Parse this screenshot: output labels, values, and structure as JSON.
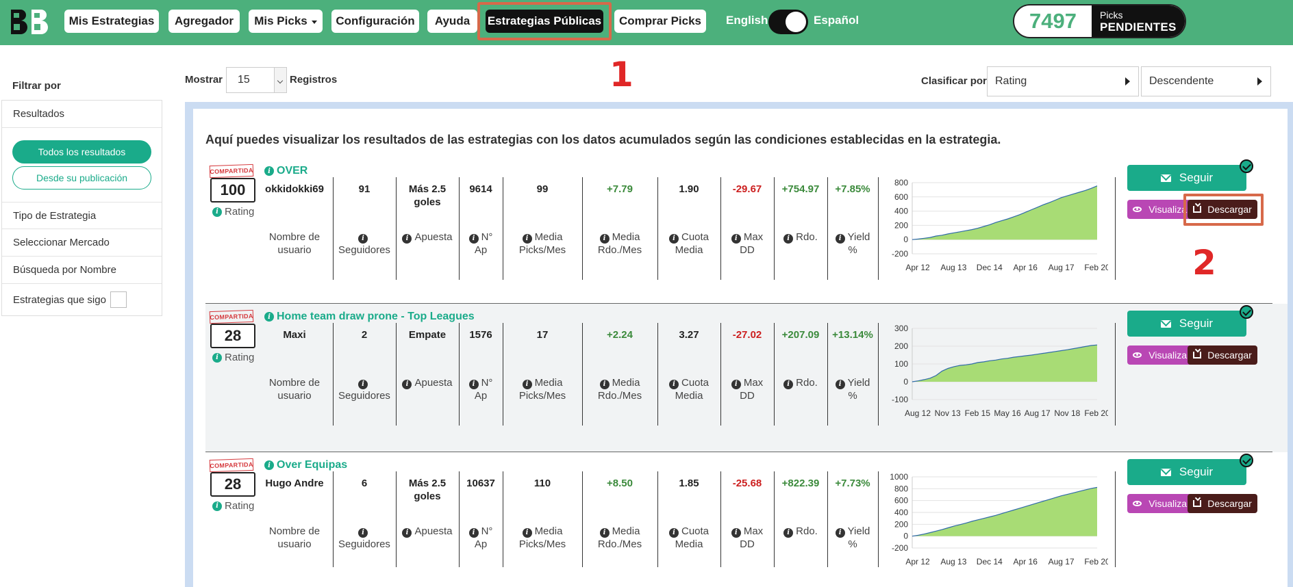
{
  "brand": {
    "logo": "BB"
  },
  "nav": {
    "items": [
      "Mis Estrategias",
      "Agregador",
      "Mis Picks",
      "Configuración",
      "Ayuda",
      "Estrategias Públicas",
      "Comprar Picks"
    ],
    "active": "Estrategias Públicas"
  },
  "lang": {
    "left": "English",
    "right": "Español"
  },
  "picks": {
    "count": "7497",
    "label1": "Picks",
    "label2": "PENDIENTES"
  },
  "annotations": {
    "one": "1",
    "two": "2"
  },
  "sidebar": {
    "title": "Filtrar por",
    "resultados": "Resultados",
    "btn_all": "Todos los resultados",
    "btn_since": "Desde su publicación",
    "tipo": "Tipo de Estrategia",
    "mercado": "Seleccionar Mercado",
    "busqueda": "Búsqueda por Nombre",
    "sigo": "Estrategias que sigo"
  },
  "controls": {
    "mostrar": "Mostrar",
    "count": "15",
    "registros": "Registros",
    "clasificar": "Clasificar por",
    "sort_field": "Rating",
    "sort_order": "Descendente"
  },
  "intro": "Aquí puedes visualizar los resultados de las estrategias con los datos acumulados según las condiciones establecidas en la estrategia.",
  "labels": {
    "stamp": "COMPARTIDA",
    "rating": "Rating",
    "user": "Nombre de usuario",
    "followers": "Seguidores",
    "bet": "Apuesta",
    "n": "N°",
    "ap": "Ap",
    "media": "Media",
    "picks_mes": "Picks/Mes",
    "rdo_mes": "Rdo./Mes",
    "cuota": "Cuota",
    "max": "Max",
    "dd": "DD",
    "rdo": "Rdo.",
    "yield": "Yield",
    "pct": "%",
    "follow": "Seguir",
    "view": "Visualizar",
    "download": "Descargar"
  },
  "colors": {
    "brand": "#4cb07c",
    "accent": "#1aab8a",
    "view": "#b947b4",
    "download": "#4a1c1a",
    "positive": "#3b8a3b",
    "negative": "#cc1f1f",
    "chart_fill": "#a8dc75",
    "chart_line": "#2f6aa8"
  },
  "strategies": [
    {
      "name": "OVER",
      "rating": "100",
      "user": "okkidokki69",
      "followers": "91",
      "bet_line1": "Más 2.5",
      "bet_line2": "goles",
      "n_ap": "9614",
      "picks_mes": "99",
      "rdo_mes": "+7.79",
      "cuota": "1.90",
      "max_dd": "-29.67",
      "rdo": "+754.97",
      "yield": "+7.85%",
      "chart": {
        "yticks": [
          "800",
          "600",
          "400",
          "200",
          "0",
          "-200"
        ],
        "xticks": [
          "Apr 12",
          "Aug 13",
          "Dec 14",
          "Apr 16",
          "Aug 17",
          "Feb 20"
        ],
        "ymin": -200,
        "ymax": 800,
        "y": [
          0,
          8,
          18,
          30,
          50,
          62,
          80,
          95,
          110,
          125,
          140,
          160,
          185,
          210,
          240,
          265,
          290,
          320,
          350,
          385,
          420,
          455,
          490,
          520,
          555,
          590,
          615,
          640,
          665,
          690,
          720,
          755
        ]
      }
    },
    {
      "name": "Home team draw prone - Top Leagues",
      "rating": "28",
      "user": "Maxi",
      "followers": "2",
      "bet_line1": "Empate",
      "bet_line2": "",
      "n_ap": "1576",
      "picks_mes": "17",
      "rdo_mes": "+2.24",
      "cuota": "3.27",
      "max_dd": "-27.02",
      "rdo": "+207.09",
      "yield": "+13.14%",
      "chart": {
        "yticks": [
          "300",
          "200",
          "100",
          "0",
          "-100"
        ],
        "xticks": [
          "Aug 12",
          "Nov 13",
          "Feb 15",
          "May 16",
          "Aug 17",
          "Nov 18",
          "Feb 20"
        ],
        "ymin": -100,
        "ymax": 300,
        "y": [
          0,
          5,
          12,
          20,
          35,
          60,
          75,
          85,
          92,
          95,
          100,
          108,
          112,
          118,
          122,
          128,
          132,
          138,
          142,
          146,
          150,
          155,
          160,
          165,
          170,
          175,
          180,
          186,
          192,
          198,
          204,
          207
        ]
      }
    },
    {
      "name": "Over Equipas",
      "rating": "28",
      "user": "Hugo Andre",
      "followers": "6",
      "bet_line1": "Más 2.5",
      "bet_line2": "goles",
      "n_ap": "10637",
      "picks_mes": "110",
      "rdo_mes": "+8.50",
      "cuota": "1.85",
      "max_dd": "-25.68",
      "rdo": "+822.39",
      "yield": "+7.73%",
      "chart": {
        "yticks": [
          "1000",
          "800",
          "600",
          "400",
          "200",
          "0",
          "-200"
        ],
        "xticks": [
          "Apr 12",
          "Aug 13",
          "Dec 14",
          "Apr 16",
          "Aug 17",
          "Feb 20"
        ],
        "ymin": -200,
        "ymax": 1000,
        "y": [
          0,
          15,
          35,
          60,
          85,
          110,
          140,
          170,
          195,
          220,
          250,
          275,
          300,
          325,
          350,
          380,
          410,
          440,
          470,
          500,
          530,
          560,
          590,
          620,
          650,
          680,
          705,
          730,
          755,
          780,
          805,
          822
        ]
      }
    }
  ]
}
